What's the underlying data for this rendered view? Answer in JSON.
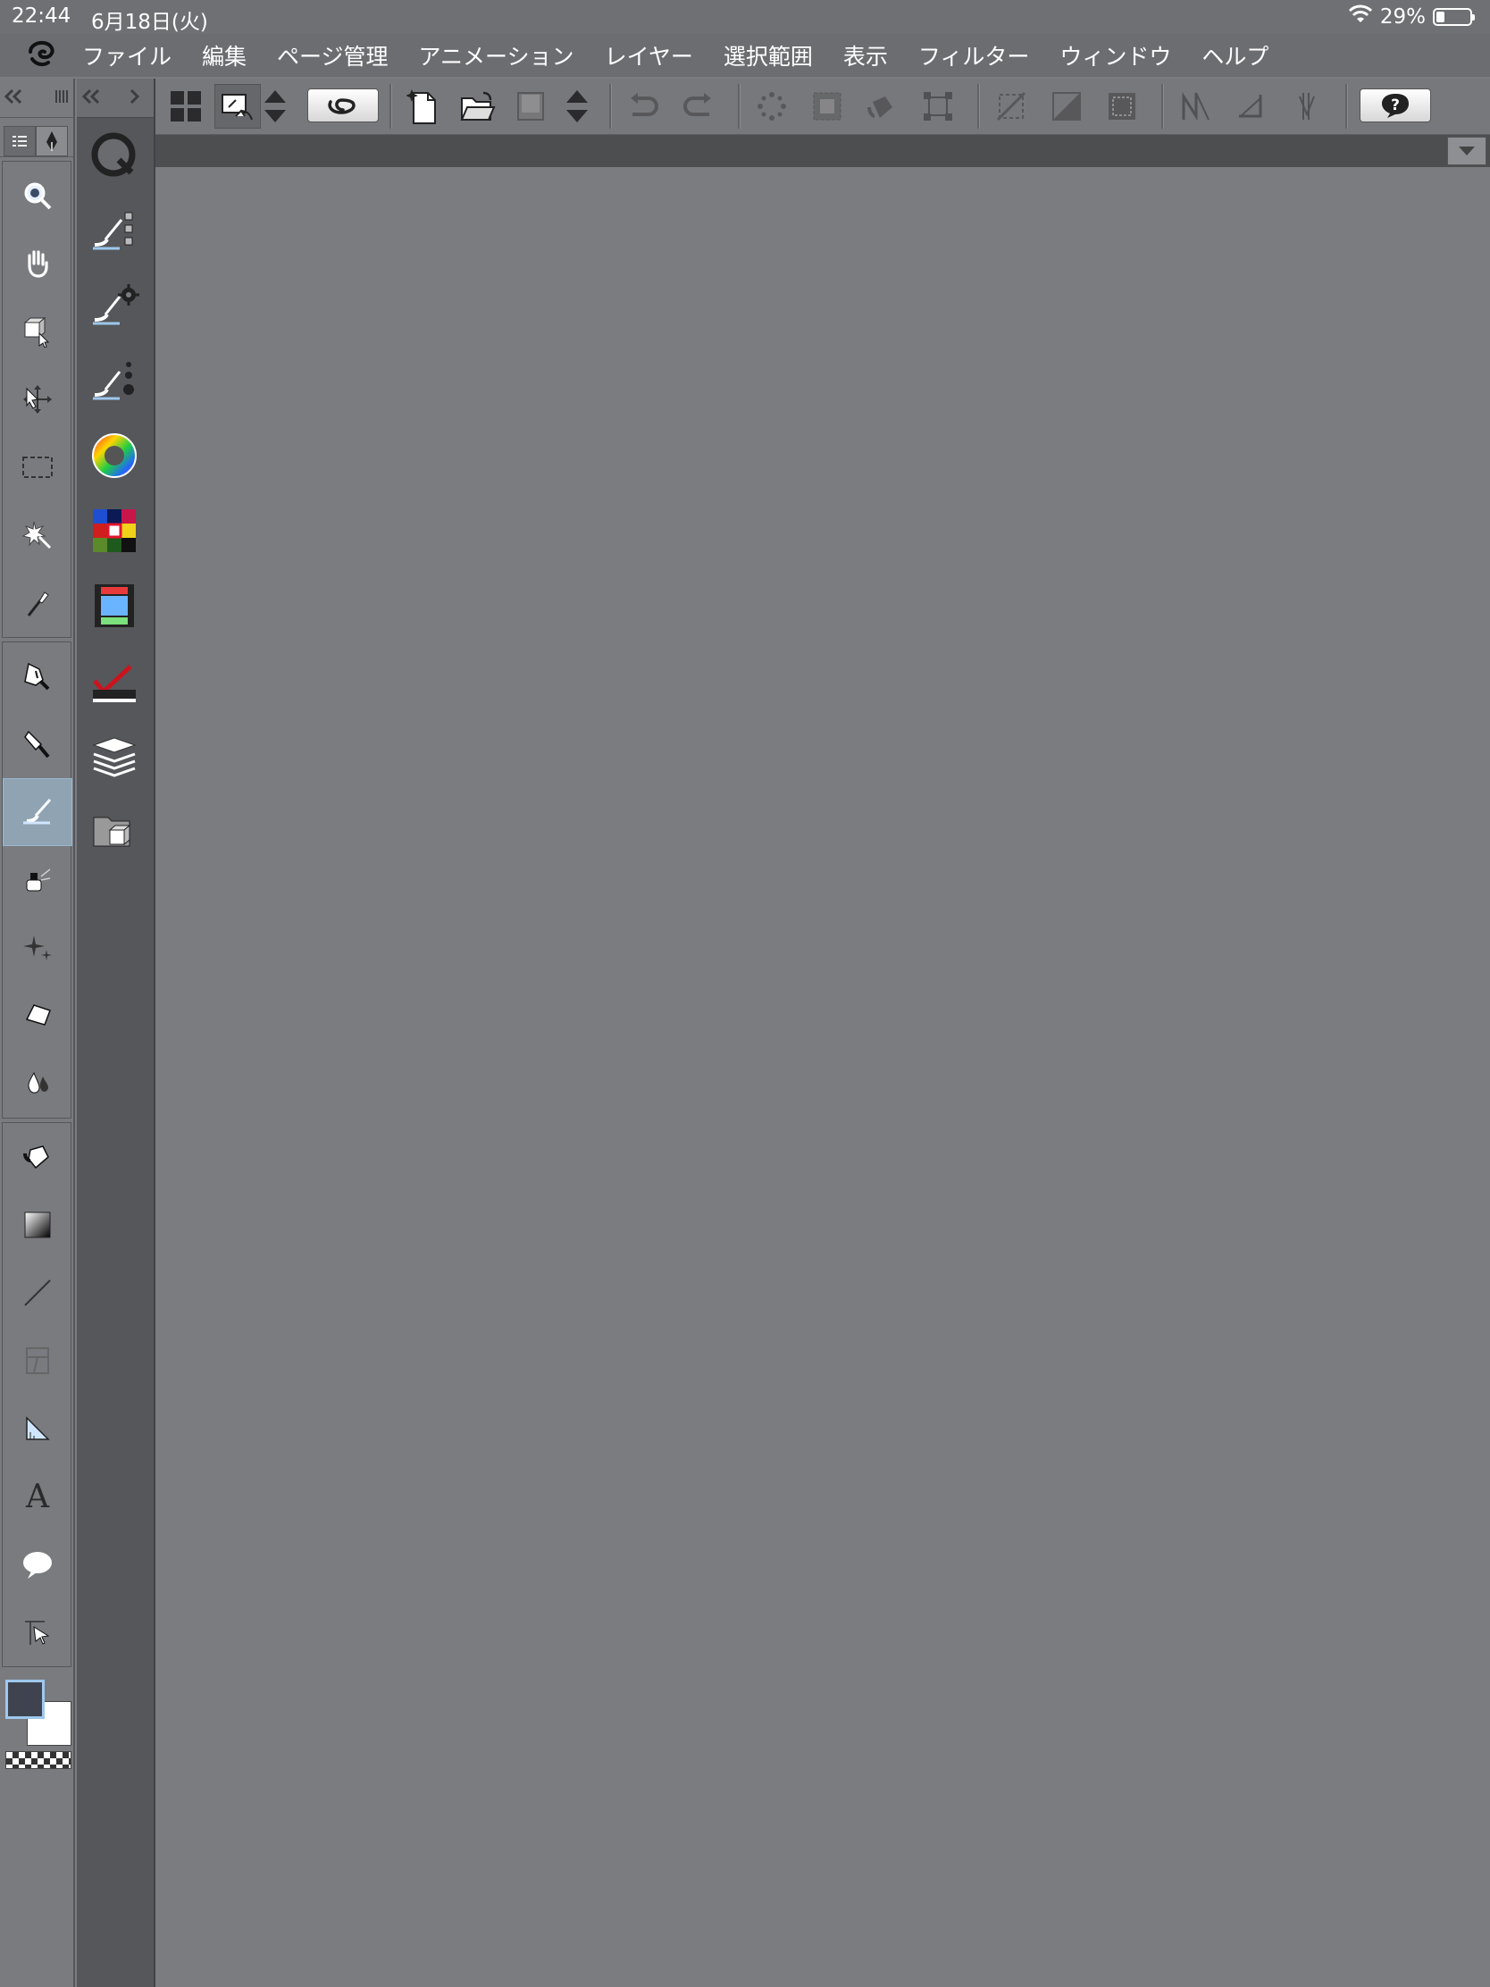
{
  "status_bar": {
    "time": "22:44",
    "date": "6月18日(火)",
    "battery": "29%",
    "battery_level": 0.29
  },
  "menu": [
    "ファイル",
    "編集",
    "ページ管理",
    "アニメーション",
    "レイヤー",
    "選択範囲",
    "表示",
    "フィルター",
    "ウィンドウ",
    "ヘルプ"
  ],
  "toolbar": {
    "icons": [
      "grid-icon",
      "canvas-gesture-icon",
      "up-down-arrows-icon",
      "link-icon",
      "new-file-icon",
      "open-folder-icon",
      "save-icon",
      "undo-icon",
      "redo-icon",
      "help-icon"
    ]
  },
  "tool_panel": {
    "tools": [
      "zoom",
      "hand",
      "operation",
      "move-layer",
      "selection",
      "auto-select",
      "eyedropper",
      "pen",
      "pencil",
      "brush",
      "airbrush",
      "decoration",
      "eraser",
      "blend",
      "fill",
      "gradient",
      "figure",
      "frame",
      "ruler",
      "text",
      "balloon",
      "correct-line"
    ],
    "selected_tool": "brush"
  },
  "colors": {
    "main": "#3f4350",
    "sub": "#ffffff",
    "accent": "#9ec8ee",
    "background": "#7b7c80"
  }
}
